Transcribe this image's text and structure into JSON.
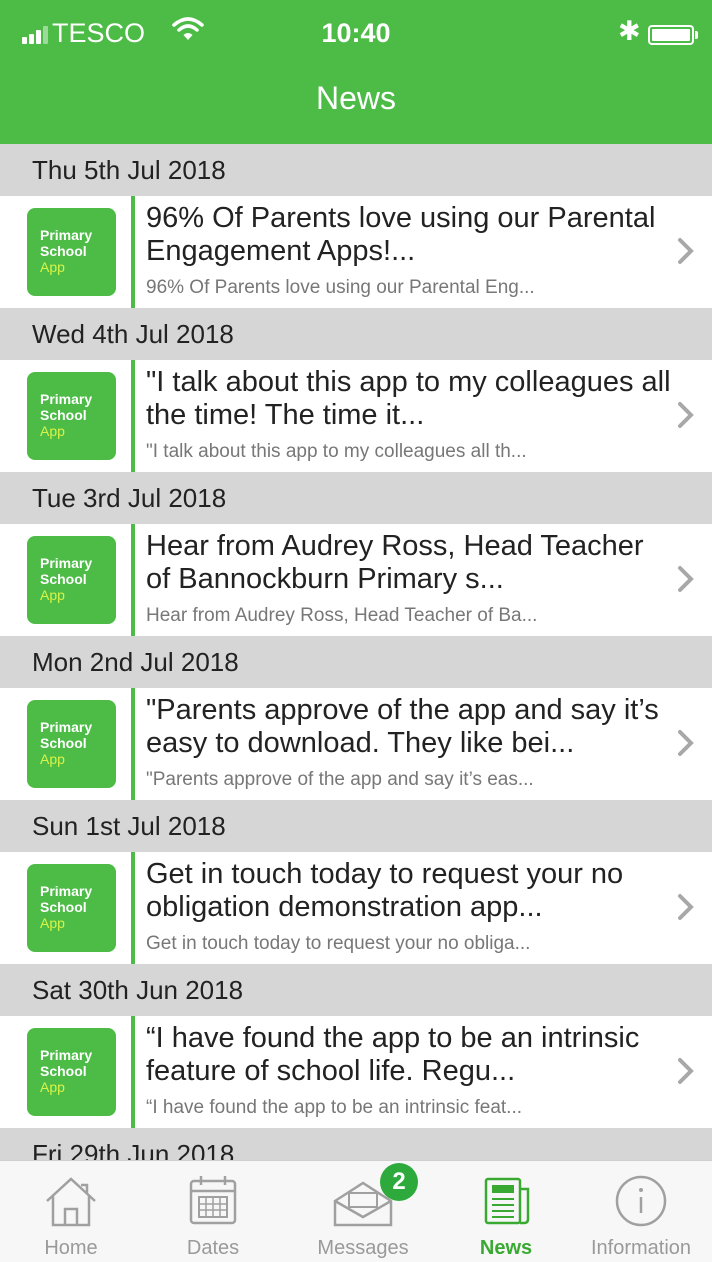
{
  "status_bar": {
    "carrier": "TESCO",
    "time": "10:40"
  },
  "header": {
    "title": "News"
  },
  "news": [
    {
      "date": "Thu 5th Jul 2018",
      "headline": "96% Of Parents love using our Parental Engagement Apps!...",
      "preview": "96% Of Parents love using our Parental Eng..."
    },
    {
      "date": "Wed 4th Jul 2018",
      "headline": "\"I talk about this app to my colleagues all the time! The time it...",
      "preview": "\"I talk about this app to my colleagues all th..."
    },
    {
      "date": "Tue 3rd Jul 2018",
      "headline": "Hear from Audrey Ross, Head Teacher of Bannockburn Primary s...",
      "preview": "Hear from Audrey Ross, Head Teacher of Ba..."
    },
    {
      "date": "Mon 2nd Jul 2018",
      "headline": "\"Parents approve of the app and say it’s easy to download.  They like bei...",
      "preview": "\"Parents approve of the app and say it’s eas..."
    },
    {
      "date": "Sun 1st Jul 2018",
      "headline": "Get in touch today to request your no obligation demonstration app...",
      "preview": "Get in touch today to request your no obliga..."
    },
    {
      "date": "Sat 30th Jun 2018",
      "headline": "“I have found the app to be an intrinsic feature of school life. Regu...",
      "preview": "“I have found the app to be an intrinsic feat..."
    },
    {
      "date": "Fri 29th Jun 2018",
      "headline": "",
      "preview": ""
    }
  ],
  "thumbnail": {
    "line1": "Primary",
    "line2": "School",
    "line3": "App"
  },
  "tabs": [
    {
      "label": "Home",
      "icon": "house-icon"
    },
    {
      "label": "Dates",
      "icon": "calendar-icon"
    },
    {
      "label": "Messages",
      "icon": "envelope-icon",
      "badge": "2"
    },
    {
      "label": "News",
      "icon": "newspaper-icon",
      "active": true
    },
    {
      "label": "Information",
      "icon": "info-icon"
    }
  ],
  "colors": {
    "brand": "#4cbc46",
    "badge": "#2eaa3c",
    "active_tab": "#3aa932"
  }
}
